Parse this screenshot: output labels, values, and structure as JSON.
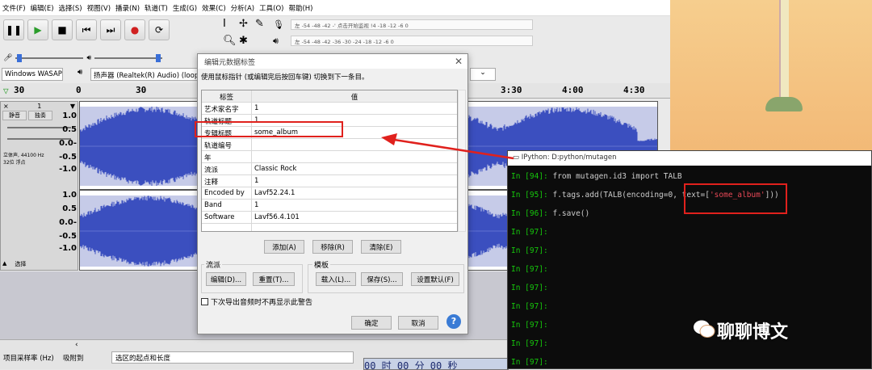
{
  "menu": [
    "文件(F)",
    "编辑(E)",
    "选择(S)",
    "视图(V)",
    "播录(N)",
    "轨道(T)",
    "生成(G)",
    "效果(C)",
    "分析(A)",
    "工具(O)",
    "帮助(H)"
  ],
  "meter_text_top": "左  -54  -48  -42  -' 点击开始监视 !4  -18  -12  -6  0",
  "meter_text_bottom": "左  -54  -48  -42  -36  -30  -24  -18  -12  -6  0",
  "host": "Windows WASAPI",
  "output_device": "扬声器 (Realtek(R) Audio) (loop",
  "ruler": {
    "left": "30",
    "marks": [
      "0",
      "30",
      "3:30",
      "4:00",
      "4:30"
    ]
  },
  "track": {
    "name": "1",
    "mute": "静音",
    "solo": "独奏",
    "rate_info": "立体声, 44100 Hz\n32位 浮点",
    "select_label": "选择",
    "scale": [
      "1.0",
      "0.5",
      "0.0-",
      "-0.5",
      "-1.0"
    ]
  },
  "bottom": {
    "rate_label": "项目采样率 (Hz)",
    "snap_label": "吸附到",
    "selection_label": "选区的起点和长度",
    "time": "00 时 00 分 00 秒"
  },
  "dialog": {
    "title": "编辑元数据标签",
    "instruction": "使用鼠标指针 (或编辑完后按回车键) 切换到下一条目。",
    "col_tag": "标签",
    "col_value": "值",
    "rows": [
      {
        "tag": "艺术家名字",
        "value": "1"
      },
      {
        "tag": "轨道标题",
        "value": "1"
      },
      {
        "tag": "专辑标题",
        "value": "some_album"
      },
      {
        "tag": "轨道编号",
        "value": ""
      },
      {
        "tag": "年",
        "value": ""
      },
      {
        "tag": "流派",
        "value": "Classic Rock"
      },
      {
        "tag": "注释",
        "value": "1"
      },
      {
        "tag": "Encoded by",
        "value": "Lavf52.24.1"
      },
      {
        "tag": "Band",
        "value": "1"
      },
      {
        "tag": "Software",
        "value": "Lavf56.4.101"
      },
      {
        "tag": "",
        "value": ""
      }
    ],
    "add": "添加(A)",
    "remove": "移除(R)",
    "clear": "清除(E)",
    "genre_group": "流派",
    "edit": "编辑(D)...",
    "reset": "重置(T)...",
    "template_group": "模板",
    "load": "载入(L)...",
    "save": "保存(S)...",
    "set_default": "设置默认(F)",
    "dont_show": "下次导出音频时不再显示此警告",
    "ok": "确定",
    "cancel": "取消",
    "help": "?"
  },
  "terminal": {
    "title": "IPython: D:python/mutagen",
    "lines": [
      {
        "prompt": "In [94]: ",
        "code": "from mutagen.id3 import TALB"
      },
      {
        "prompt": "In [95]: ",
        "code": "f.tags.add(TALB(encoding=0, text=[",
        "str": "'some_album'",
        "tail": "]))"
      },
      {
        "prompt": "In [96]: ",
        "code": "f.save()"
      },
      {
        "prompt": "In [97]: ",
        "code": ""
      },
      {
        "prompt": "In [97]: ",
        "code": ""
      },
      {
        "prompt": "In [97]: ",
        "code": ""
      },
      {
        "prompt": "In [97]: ",
        "code": ""
      },
      {
        "prompt": "In [97]: ",
        "code": ""
      },
      {
        "prompt": "In [97]: ",
        "code": ""
      },
      {
        "prompt": "In [97]: ",
        "code": ""
      },
      {
        "prompt": "In [97]: ",
        "code": ""
      }
    ]
  },
  "watermark": "聊聊博文"
}
